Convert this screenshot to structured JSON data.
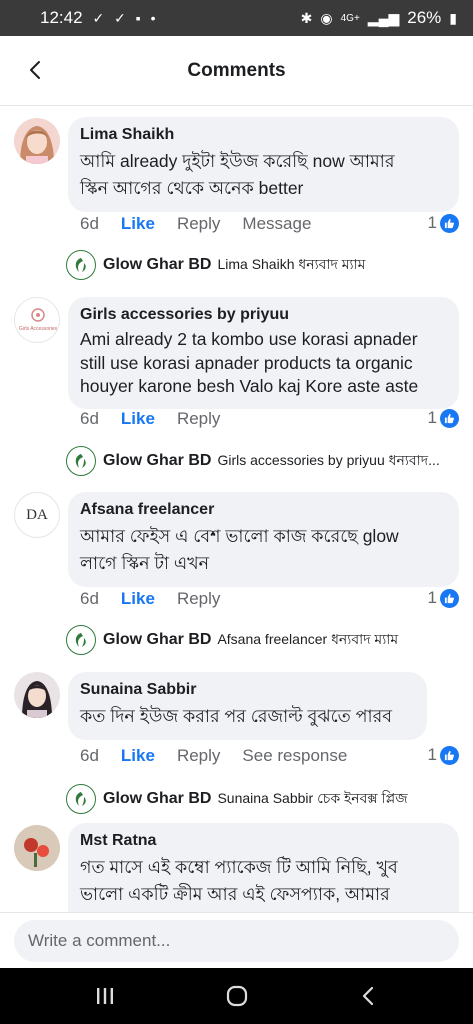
{
  "status_bar": {
    "time": "12:42",
    "left_icons": "✓ ✓ ▪ •",
    "network": "4G+",
    "battery": "26%"
  },
  "header": {
    "title": "Comments"
  },
  "comments": [
    {
      "author": "Lima Shaikh",
      "text_lines": [
        "আমি already দুইটা ইউজ করেছি  now আমার",
        "স্কিন আগের থেকে অনেক better"
      ],
      "time": "6d",
      "like": "Like",
      "reply": "Reply",
      "extra": "Message",
      "reactions": "1",
      "reply_preview": {
        "name": "Glow Ghar BD",
        "text": "Lima Shaikh ধন্যবাদ ম্যাম"
      }
    },
    {
      "author": "Girls accessories by priyuu",
      "avatar_text": "Girls Accessories",
      "text_lines": [
        "Ami already 2 ta kombo use korasi apnader",
        "still use korasi apnader products ta organic",
        "houyer karone besh Valo kaj Kore aste aste"
      ],
      "time": "6d",
      "like": "Like",
      "reply": "Reply",
      "reactions": "1",
      "reply_preview": {
        "name": "Glow Ghar BD",
        "text": "Girls accessories by priyuu ধন্যবাদ..."
      }
    },
    {
      "author": "Afsana freelancer",
      "avatar_text": "DA",
      "text_lines": [
        "আমার ফেইস এ বেশ ভালো কাজ করেছে  glow",
        "লাগে স্কিন টা এখন"
      ],
      "time": "6d",
      "like": "Like",
      "reply": "Reply",
      "reactions": "1",
      "reply_preview": {
        "name": "Glow Ghar BD",
        "text": "Afsana freelancer ধন্যবাদ ম্যাম"
      }
    },
    {
      "author": "Sunaina Sabbir",
      "text_lines": [
        "কত দিন ইউজ করার পর রেজাল্ট বুঝতে পারব"
      ],
      "time": "6d",
      "like": "Like",
      "reply": "Reply",
      "extra": "See response",
      "reactions": "1",
      "reply_preview": {
        "name": "Glow Ghar BD",
        "text": "Sunaina Sabbir চেক ইনবক্স প্লিজ"
      }
    },
    {
      "author": "Mst Ratna",
      "text_lines": [
        "গত মাসে এই কম্বো প্যাকেজ টি আমি নিছি, খুব",
        "ভালো একটি ক্রীম আর এই ফেসপ্যাক, আমার"
      ]
    }
  ],
  "composer": {
    "placeholder": "Write a comment..."
  },
  "colors": {
    "accent": "#1877f2",
    "bubble": "#f0f2f5",
    "meta": "#65676b",
    "brand_green": "#2f7a3b"
  },
  "icons": [
    "back-arrow-icon",
    "like-thumb-icon",
    "glow-ghar-logo",
    "recents-icon",
    "home-icon",
    "back-nav-icon"
  ]
}
